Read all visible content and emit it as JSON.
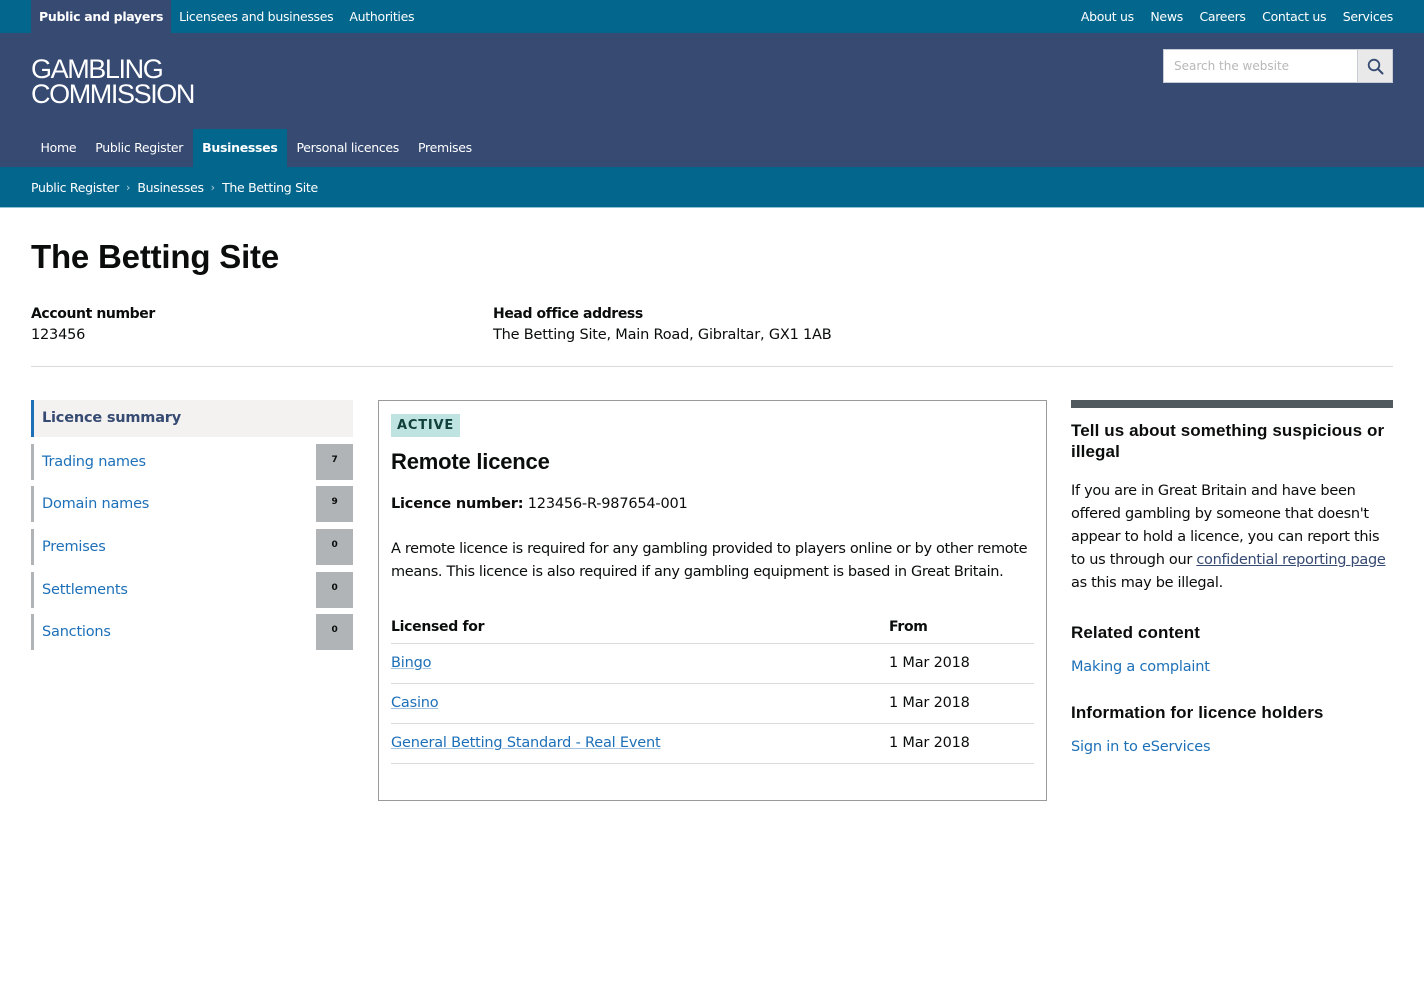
{
  "topbar": {
    "left_links": [
      {
        "label": "Public and players",
        "active": true
      },
      {
        "label": "Licensees and businesses",
        "active": false
      },
      {
        "label": "Authorities",
        "active": false
      }
    ],
    "right_links": [
      {
        "label": "About us"
      },
      {
        "label": "News"
      },
      {
        "label": "Careers"
      },
      {
        "label": "Contact us"
      },
      {
        "label": "Services"
      }
    ]
  },
  "header": {
    "logo_line1": "GAMBLING",
    "logo_line2": "COMMISSION",
    "search": {
      "placeholder": "Search the website",
      "value": "",
      "button_icon": "search-icon"
    },
    "nav": [
      {
        "label": "Home",
        "active": false
      },
      {
        "label": "Public Register",
        "active": false
      },
      {
        "label": "Businesses",
        "active": true
      },
      {
        "label": "Personal licences",
        "active": false
      },
      {
        "label": "Premises",
        "active": false
      }
    ]
  },
  "breadcrumb": {
    "items": [
      "Public Register",
      "Businesses",
      "The Betting Site"
    ],
    "separator_icon": "chevron-right-icon"
  },
  "page": {
    "title": "The Betting Site",
    "account_label": "Account number",
    "account_value": "123456",
    "address_label": "Head office address",
    "address_value": "The Betting Site, Main Road, Gibraltar, GX1 1AB"
  },
  "sidebar": {
    "summary_label": "Licence summary",
    "items": [
      {
        "label": "Trading names",
        "count": "7"
      },
      {
        "label": "Domain names",
        "count": "9"
      },
      {
        "label": "Premises",
        "count": "0"
      },
      {
        "label": "Settlements",
        "count": "0"
      },
      {
        "label": "Sanctions",
        "count": "0"
      }
    ]
  },
  "licence": {
    "status": "ACTIVE",
    "title": "Remote licence",
    "number_label": "Licence number:",
    "number_value": "123456-R-987654-001",
    "description": "A remote licence is required for any gambling provided to players online or by other remote means. This licence is also required if any gambling equipment is based in Great Britain.",
    "table": {
      "headers": [
        "Licensed for",
        "From"
      ],
      "rows": [
        {
          "activity": "Bingo",
          "from": "1 Mar 2018"
        },
        {
          "activity": "Casino",
          "from": "1 Mar 2018"
        },
        {
          "activity": "General Betting Standard - Real Event",
          "from": "1 Mar 2018"
        }
      ]
    }
  },
  "aside": {
    "suspicious_heading": "Tell us about something suspicious or illegal",
    "suspicious_text_before": "If you are in Great Britain and have been offered gambling by someone that doesn't appear to hold a licence, you can report this to us through our ",
    "suspicious_link": "confidential reporting page",
    "suspicious_text_after": " as this may be illegal.",
    "related_heading": "Related content",
    "related_link": "Making a complaint",
    "info_heading": "Information for licence holders",
    "info_link": "Sign in to eServices"
  },
  "colors": {
    "topbar": "#03668d",
    "header": "#364a72",
    "link": "#1d70b8",
    "badge_bg": "#bfe3e0",
    "count_bg": "#b1b4b6",
    "aside_bar": "#505a5f"
  }
}
